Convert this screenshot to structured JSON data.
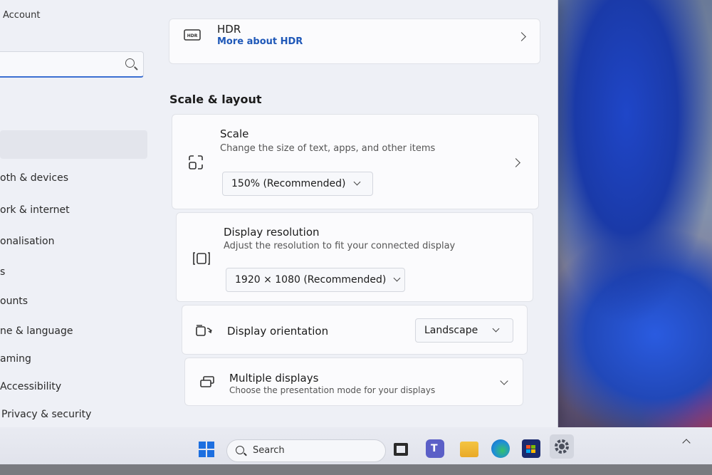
{
  "sidebar": {
    "account_label": "Account",
    "search_placeholder": "",
    "items": [
      {
        "label": "oth & devices"
      },
      {
        "label": "ork & internet"
      },
      {
        "label": "onalisation"
      },
      {
        "label": "s"
      },
      {
        "label": "ounts"
      },
      {
        "label": "ne & language"
      },
      {
        "label": "aming"
      },
      {
        "label": "Accessibility"
      },
      {
        "label": "Privacy & security"
      }
    ]
  },
  "content": {
    "hdr": {
      "title": "HDR",
      "link": "More about HDR"
    },
    "section_title": "Scale & layout",
    "scale": {
      "title": "Scale",
      "subtitle": "Change the size of text, apps, and other items",
      "value": "150% (Recommended)"
    },
    "resolution": {
      "title": "Display resolution",
      "subtitle": "Adjust the resolution to fit your connected display",
      "value": "1920 × 1080 (Recommended)"
    },
    "orientation": {
      "title": "Display orientation",
      "value": "Landscape"
    },
    "multiple": {
      "title": "Multiple displays",
      "subtitle": "Choose the presentation mode for your displays"
    }
  },
  "taskbar": {
    "search_label": "Search",
    "apps": [
      "start-icon",
      "search",
      "task-view-icon",
      "teams-icon",
      "file-explorer-icon",
      "edge-icon",
      "store-icon",
      "settings-icon"
    ]
  },
  "colors": {
    "accent": "#1f58b8",
    "window_bg": "#eef0f6",
    "card_bg": "#fbfbfd"
  }
}
